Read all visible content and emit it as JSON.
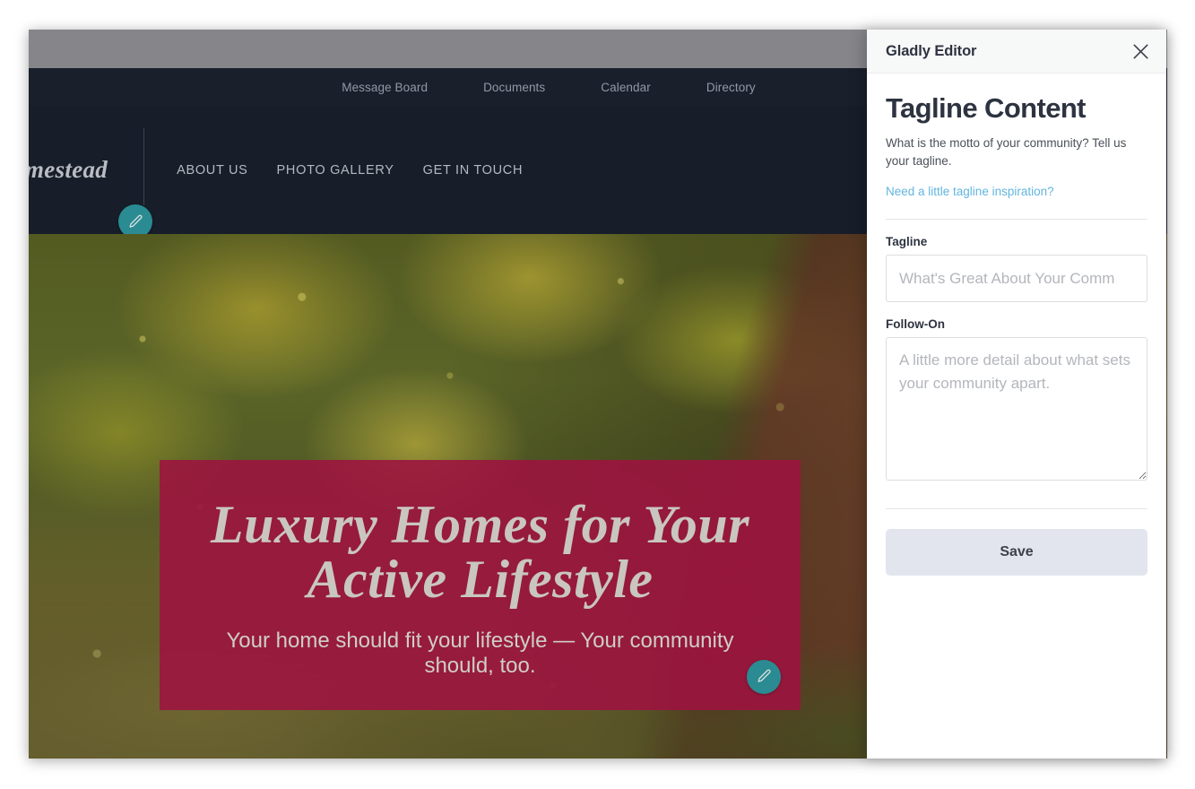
{
  "site": {
    "brand": "mestead",
    "utility_nav": [
      {
        "label": "Message Board"
      },
      {
        "label": "Documents"
      },
      {
        "label": "Calendar"
      },
      {
        "label": "Directory"
      }
    ],
    "main_nav": [
      {
        "label": "ABOUT US"
      },
      {
        "label": "PHOTO GALLERY"
      },
      {
        "label": "GET IN TOUCH"
      }
    ],
    "hero": {
      "tagline": "Luxury Homes for Your Active Lifestyle",
      "follow_on": "Your home should fit your lifestyle — Your community should, too."
    },
    "edit_nav_icon": "pencil-icon",
    "edit_hero_icon": "pencil-icon"
  },
  "panel": {
    "title": "Gladly Editor",
    "close_icon": "close-icon",
    "section_title": "Tagline Content",
    "section_description": "What is the motto of your community? Tell us your tagline.",
    "inspiration_link": "Need a little tagline inspiration?",
    "fields": {
      "tagline": {
        "label": "Tagline",
        "value": "",
        "placeholder": "What's Great About Your Comm"
      },
      "follow_on": {
        "label": "Follow-On",
        "value": "",
        "placeholder": "A little more detail about what sets your community apart."
      }
    },
    "save_label": "Save"
  },
  "colors": {
    "teal_accent": "#2a8b92",
    "crimson_block": "#9e1240",
    "panel_header_bg": "#f7f8f8",
    "link_blue": "#62b5de",
    "save_bg": "#e2e5ee",
    "nav_dark": "#191f2b",
    "chrome_gray": "#85858a"
  }
}
